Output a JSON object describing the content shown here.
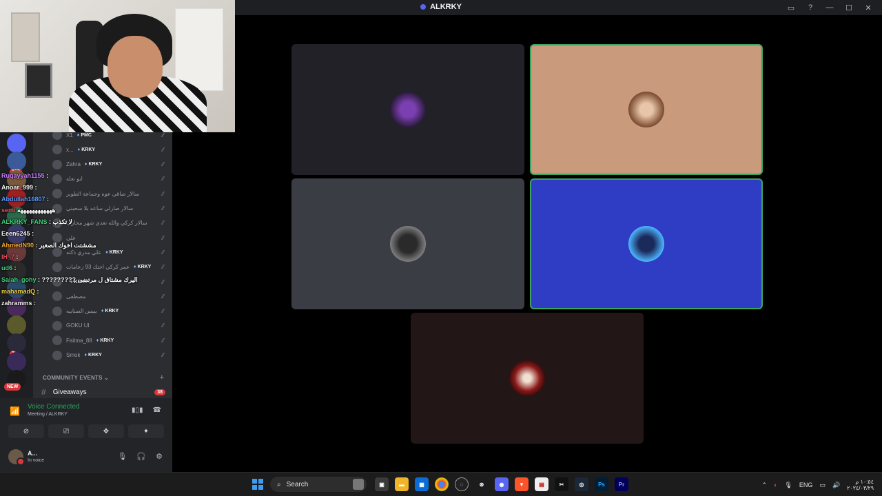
{
  "window": {
    "title": "ALKRKY"
  },
  "members": [
    {
      "name": "X1",
      "tag": "PMC"
    },
    {
      "name": "x...",
      "tag": "KRKY"
    },
    {
      "name": "Zahra",
      "tag": "KRKY"
    },
    {
      "name": "ابو نعله",
      "tag": ""
    },
    {
      "name": "سالار صاقي عوه وجماعة الطوبر",
      "tag": ""
    },
    {
      "name": "سالار صارلي ساعه بلا سحبني",
      "tag": ""
    },
    {
      "name": "سالار كركي والله نعدي شهر محارب",
      "tag": ""
    },
    {
      "name": "علي",
      "tag": ""
    },
    {
      "name": "علي مدري ذكته",
      "tag": "KRKY"
    },
    {
      "name": "عمر كركي احتك 93 زعامات",
      "tag": "KRKY"
    },
    {
      "name": "",
      "tag": "KRKY"
    },
    {
      "name": "مصطفى",
      "tag": ""
    },
    {
      "name": "بيبس الصنابيه",
      "tag": "KRKY"
    },
    {
      "name": "GOKU UI",
      "tag": ""
    },
    {
      "name": "Faitma_88",
      "tag": "KRKY"
    },
    {
      "name": "Smok",
      "tag": "KRKY"
    }
  ],
  "servers": [
    {
      "badge": ""
    },
    {
      "badge": "102"
    },
    {
      "badge": "208"
    },
    {
      "badge": ""
    },
    {
      "badge": ""
    },
    {
      "badge": ""
    },
    {
      "badge": ""
    },
    {
      "badge": ""
    },
    {
      "badge": ""
    },
    {
      "badge": ""
    },
    {
      "badge": ""
    },
    {
      "badge": "2"
    },
    {
      "badge": ""
    },
    {
      "badge": ""
    }
  ],
  "new_label": "NEW",
  "category": {
    "label": "COMMUNITY EVENTS",
    "plus": "+"
  },
  "channel": {
    "name": "Giveaways",
    "count": "38"
  },
  "chat": [
    {
      "user": "Ruqayyah1155",
      "msg": ":",
      "color": "#c77dff"
    },
    {
      "user": "Anoar_999",
      "msg": ":",
      "color": "#f2f3f5"
    },
    {
      "user": "Abdullah16807",
      "msg": ":",
      "color": "#5b9bff"
    },
    {
      "user": "semi",
      "msg": "ههههههههههههه",
      "color": "#e8505b"
    },
    {
      "user": "ALKRKY_FANS",
      "msg": ": لا تكذب",
      "color": "#43d17a"
    },
    {
      "user": "Eeen6245",
      "msg": ":",
      "color": "#f2f3f5"
    },
    {
      "user": "AhmedN90",
      "msg": ": مششتت اخوك الصغير",
      "color": "#f0a830"
    },
    {
      "user": "IH_7",
      "msg": ":",
      "color": "#e8505b"
    },
    {
      "user": "ud6",
      "msg": ":",
      "color": "#43d17a"
    },
    {
      "user": "Salah_gohy",
      "msg": ": ????????? اليرك مشتاق ل مرتضى",
      "color": "#43d17a"
    },
    {
      "user": "mahamadQ",
      "msg": ":",
      "color": "#f0d040"
    },
    {
      "user": "zahramms",
      "msg": ":",
      "color": "#f2f3f5"
    }
  ],
  "voice": {
    "status": "Voice Connected",
    "location": "Meeting / ALKRKY"
  },
  "user": {
    "name": "A...",
    "status": "In voice"
  },
  "taskbar": {
    "search_label": "Search",
    "lang": "ENG",
    "time": "١٠:٥٤ م",
    "date": "٢٠٢٤/٠٣/٢٩",
    "apps": [
      "task-view",
      "file-explorer",
      "store",
      "chrome",
      "app",
      "steam-client",
      "discord",
      "brave",
      "news",
      "capcut",
      "steam",
      "photoshop",
      "premiere"
    ]
  },
  "colors": {
    "tile1": "#232128",
    "tile2": "#c99a7c",
    "tile3": "#3a3d44",
    "tile4": "#2f3cc4",
    "tile5": "#231617",
    "speaking": "#3ba55d"
  }
}
